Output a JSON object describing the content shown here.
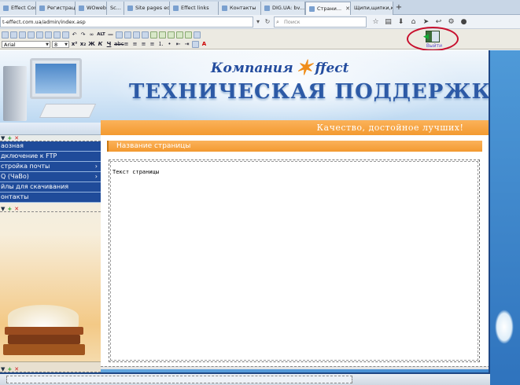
{
  "browser": {
    "tabs": [
      {
        "label": "Effect Control",
        "active": false
      },
      {
        "label": "Регистрац...",
        "active": false
      },
      {
        "label": "WOweb.ru",
        "active": false
      },
      {
        "label": "Sc...",
        "active": false
      },
      {
        "label": "Site pages editor",
        "active": false
      },
      {
        "label": "Effect links",
        "active": false
      },
      {
        "label": "Контакты",
        "active": false
      },
      {
        "label": "DIG.UA: bv...",
        "active": false
      },
      {
        "label": "Страни...",
        "active": true
      },
      {
        "label": "Щипи,щипки,к...",
        "active": false
      }
    ],
    "new_tab": "+",
    "url": "t-effect.com.ua/admin/index.asp",
    "search_placeholder": "Поиск",
    "nav_icons": [
      "star-icon",
      "clipboard-icon",
      "download-icon",
      "home-icon",
      "send-icon",
      "back-icon",
      "gear-icon",
      "chat-icon"
    ]
  },
  "editor": {
    "font_name": "Arial",
    "font_size": "8",
    "exit_label": "Выйти"
  },
  "site": {
    "logo_text": "Компания",
    "logo_brand": "ffect",
    "header_title": "ТЕХНИЧЕСКАЯ ПОДДЕРЖКА",
    "slogan": "Качество, достойное лучших!",
    "menu": [
      {
        "label": "аозная",
        "chevron": false
      },
      {
        "label": "дключение к FTP",
        "chevron": false
      },
      {
        "label": "стройка почты",
        "chevron": true
      },
      {
        "label": "Q (ЧаВо)",
        "chevron": true
      },
      {
        "label": "йлы для скачивания",
        "chevron": false
      },
      {
        "label": "онтакты",
        "chevron": false
      }
    ],
    "tool_icons": {
      "down": "▼",
      "add": "+",
      "remove": "✕"
    },
    "page_title": "Название страницы",
    "page_text": "Текст страницы"
  }
}
